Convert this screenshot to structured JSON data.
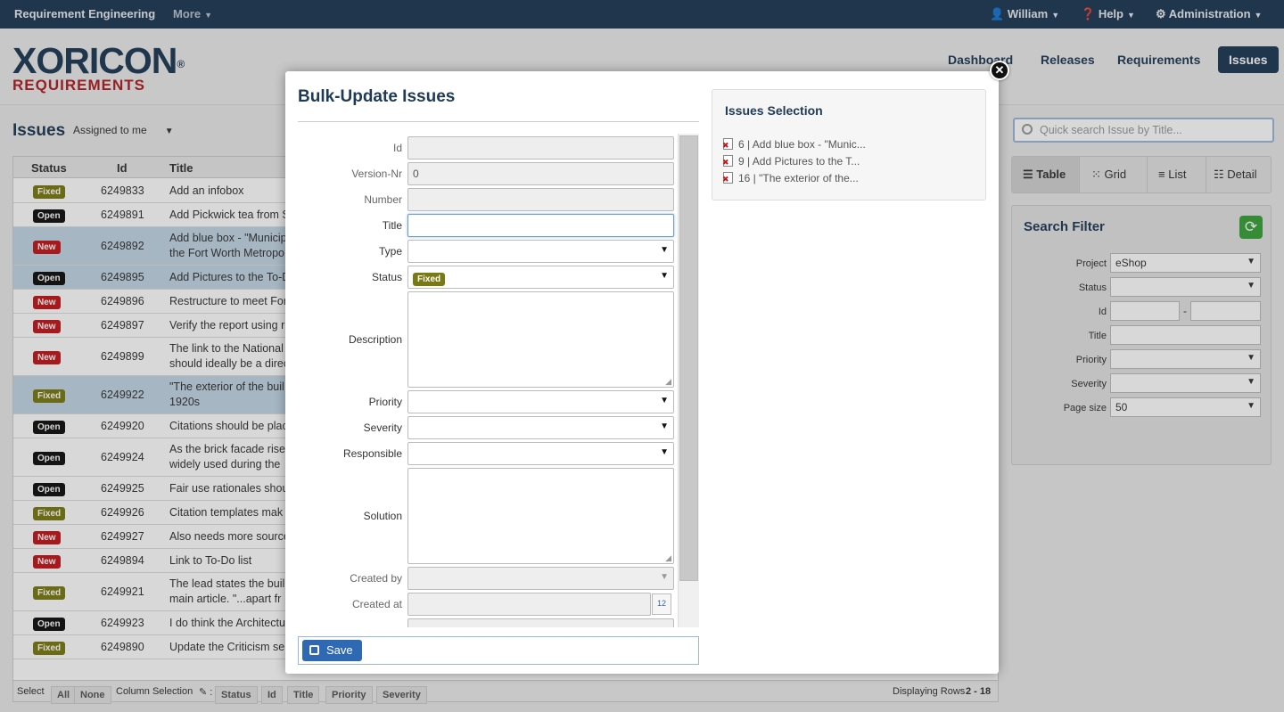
{
  "topbar": {
    "app": "Requirement Engineering",
    "more": "More",
    "user": "William",
    "help": "Help",
    "admin": "Administration"
  },
  "logo": {
    "text": "XORICON",
    "sub": "REQUIREMENTS",
    "reg": "®"
  },
  "nav": {
    "dashboard": "Dashboard",
    "releases": "Releases",
    "requirements": "Requirements",
    "issues": "Issues"
  },
  "list": {
    "title": "Issues",
    "filter": "Assigned to me",
    "col_status": "Status",
    "col_id": "Id",
    "col_title": "Title"
  },
  "rows": [
    {
      "status": "Fixed",
      "id": "6249833",
      "title": "Add an infobox"
    },
    {
      "status": "Open",
      "id": "6249891",
      "title": "Add Pickwick tea from S"
    },
    {
      "status": "New",
      "id": "6249892",
      "title": "Add blue box - \"Municip the Fort Worth Metropo"
    },
    {
      "status": "Open",
      "id": "6249895",
      "title": "Add Pictures to the To-D"
    },
    {
      "status": "New",
      "id": "6249896",
      "title": "Restructure to meet For"
    },
    {
      "status": "New",
      "id": "6249897",
      "title": "Verify the report using r"
    },
    {
      "status": "New",
      "id": "6249899",
      "title": "The link to the National should ideally be a direc"
    },
    {
      "status": "Fixed",
      "id": "6249922",
      "title": "\"The exterior of the buil 1920s"
    },
    {
      "status": "Open",
      "id": "6249920",
      "title": "Citations should be plac"
    },
    {
      "status": "Open",
      "id": "6249924",
      "title": "As the brick facade rise widely used during the"
    },
    {
      "status": "Open",
      "id": "6249925",
      "title": "Fair use rationales shou"
    },
    {
      "status": "Fixed",
      "id": "6249926",
      "title": "Citation templates mak"
    },
    {
      "status": "New",
      "id": "6249927",
      "title": "Also needs more source"
    },
    {
      "status": "New",
      "id": "6249894",
      "title": "Link to To-Do list"
    },
    {
      "status": "Fixed",
      "id": "6249921",
      "title": "The lead states the buil main article. \"...apart fr"
    },
    {
      "status": "Open",
      "id": "6249923",
      "title": "I do think the Architectu"
    },
    {
      "status": "Fixed",
      "id": "6249890",
      "title": "Update the Criticism se"
    }
  ],
  "footer": {
    "select": "Select",
    "all": "All",
    "none": "None",
    "colsel": "Column Selection",
    "c1": "Status",
    "c2": "Id",
    "c3": "Title",
    "c4": "Priority",
    "c5": "Severity",
    "displaying": "Displaying Rows",
    "range": "2 - 18"
  },
  "right": {
    "search_placeholder": "Quick search Issue by Title...",
    "views": [
      "Table",
      "Grid",
      "List",
      "Detail"
    ],
    "filter_title": "Search Filter",
    "project_label": "Project",
    "project_value": "eShop",
    "status_label": "Status",
    "id_label": "Id",
    "title_label": "Title",
    "priority_label": "Priority",
    "severity_label": "Severity",
    "pagesize_label": "Page size",
    "pagesize_value": "50",
    "range_dash": "-"
  },
  "modal": {
    "title": "Bulk-Update Issues",
    "id_label": "Id",
    "version_label": "Version-Nr",
    "version_value": "0",
    "number_label": "Number",
    "title_label": "Title",
    "type_label": "Type",
    "status_label": "Status",
    "status_value": "Fixed",
    "description_label": "Description",
    "priority_label": "Priority",
    "severity_label": "Severity",
    "responsible_label": "Responsible",
    "solution_label": "Solution",
    "createdby_label": "Created by",
    "createdat_label": "Created at",
    "calendar": "12",
    "save": "Save",
    "selection_title": "Issues Selection",
    "selection": [
      "6 | Add blue box - \"Munic...",
      "9 | Add Pictures to the T...",
      "16 | \"The exterior of the..."
    ]
  },
  "colors": {
    "navy": "#1f3a56",
    "brand_red": "#b01e23",
    "fixed": "#7a7a12",
    "new": "#c2161b",
    "open": "#111111"
  }
}
